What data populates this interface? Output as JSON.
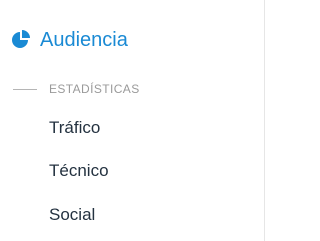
{
  "header": {
    "icon": "pie-chart-icon",
    "title": "Audiencia",
    "color": "#1a8ad4"
  },
  "section": {
    "label": "ESTADÍSTICAS"
  },
  "nav": {
    "items": [
      {
        "label": "Tráfico"
      },
      {
        "label": "Técnico"
      },
      {
        "label": "Social"
      }
    ]
  }
}
